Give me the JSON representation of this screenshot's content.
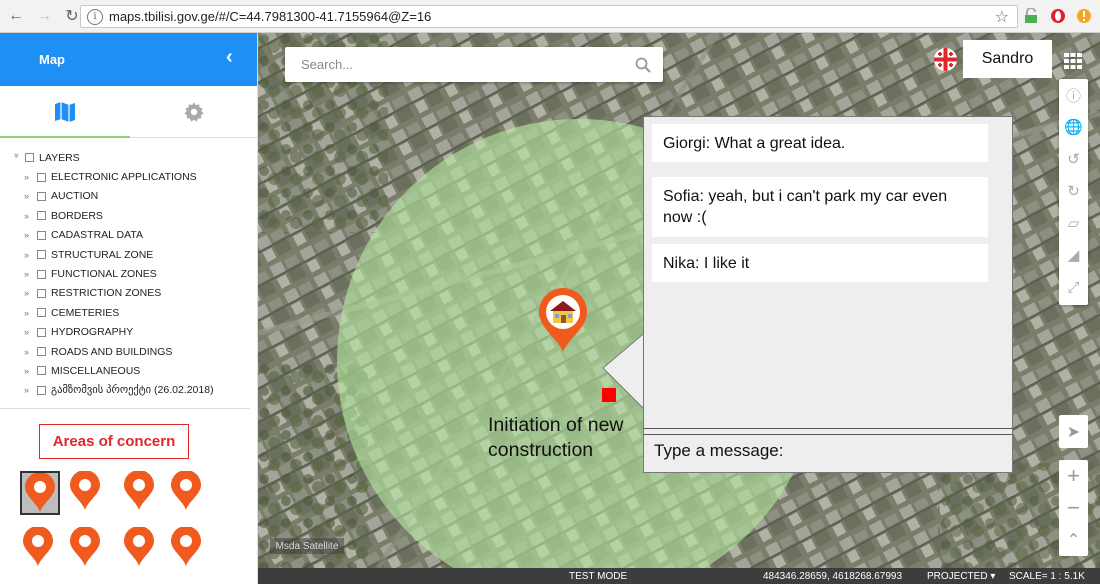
{
  "browser": {
    "url": "maps.tbilisi.gov.ge/#/C=44.7981300-41.7155964@Z=16",
    "info_glyph": "i"
  },
  "sidebar": {
    "title": "Map",
    "layers": [
      {
        "label": "LAYERS",
        "level": 0
      },
      {
        "label": "ELECTRONIC APPLICATIONS",
        "level": 1
      },
      {
        "label": "AUCTION",
        "level": 1
      },
      {
        "label": "BORDERS",
        "level": 1
      },
      {
        "label": "CADASTRAL DATA",
        "level": 1
      },
      {
        "label": "STRUCTURAL ZONE",
        "level": 1
      },
      {
        "label": "FUNCTIONAL ZONES",
        "level": 1
      },
      {
        "label": "RESTRICTION ZONES",
        "level": 1
      },
      {
        "label": "CEMETERIES",
        "level": 1
      },
      {
        "label": "HYDROGRAPHY",
        "level": 1
      },
      {
        "label": "ROADS AND BUILDINGS",
        "level": 1
      },
      {
        "label": "MISCELLANEOUS",
        "level": 1
      },
      {
        "label": "გამზომვის პროექტი (26.02.2018)",
        "level": 1
      }
    ],
    "concern_label": "Areas of concern"
  },
  "map": {
    "search_placeholder": "Search...",
    "user_name": "Sandro",
    "pin_label_line1": "Initiation of new",
    "pin_label_line2": "construction",
    "satellite_label": "Msda Satellite",
    "area_fill": "#b4e6a0",
    "pin_color": "#f05a1e",
    "marker_color": "#ff0000"
  },
  "chat": {
    "messages": [
      {
        "text": "Giorgi: What a great idea."
      },
      {
        "text": "Sofia: yeah, but i can't park my car even now :("
      },
      {
        "text": "Nika: I like it"
      }
    ],
    "input_label": "Type a message:"
  },
  "statusbar": {
    "mode": "TEST MODE",
    "coords": "484346.28659, 4618268.67993",
    "projection": "PROJECTED",
    "scale": "SCALE= 1 : 5.1K"
  },
  "icons": [
    "back-icon",
    "forward-icon",
    "reload-icon",
    "info-icon",
    "star-icon",
    "map-icon",
    "gear-icon",
    "search-icon",
    "flag-icon",
    "grid-icon",
    "zoom-in-icon",
    "zoom-out-icon",
    "locate-icon"
  ]
}
